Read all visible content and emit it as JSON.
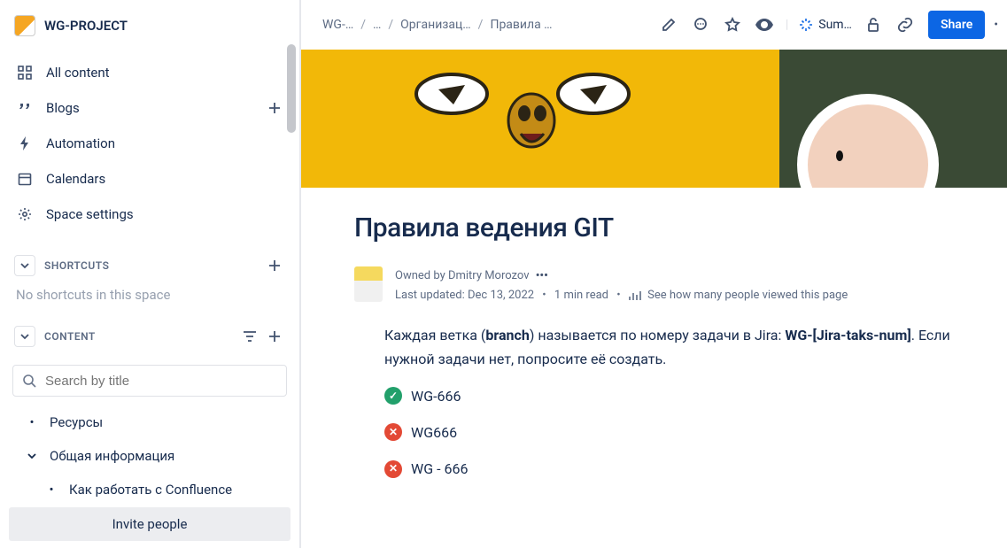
{
  "sidebar": {
    "spaceTitle": "WG-PROJECT",
    "nav": {
      "allContent": "All content",
      "blogs": "Blogs",
      "automation": "Automation",
      "calendars": "Calendars",
      "spaceSettings": "Space settings"
    },
    "sections": {
      "shortcuts": {
        "label": "SHORTCUTS",
        "empty": "No shortcuts in this space"
      },
      "content": {
        "label": "CONTENT"
      }
    },
    "searchPlaceholder": "Search by title",
    "tree": {
      "resources": "Ресурсы",
      "commonInfo": "Общая информация",
      "confluence": "Как работать с Confluence"
    },
    "invite": "Invite people"
  },
  "topbar": {
    "crumbs": [
      "WG-…",
      "…",
      "Организац…",
      "Правила …"
    ],
    "summarize": "Sum…",
    "share": "Share"
  },
  "page": {
    "title": "Правила ведения GIT",
    "ownedByPrefix": "Owned by ",
    "owner": "Dmitry Morozov",
    "updatedPrefix": "Last updated: ",
    "updated": "Dec 13, 2022",
    "readTime": "1 min read",
    "viewsLink": "See how many people viewed this page",
    "body": {
      "p1_a": "Каждая ветка (",
      "p1_bold": "branch",
      "p1_b": ") называется по номеру задачи в Jira: ",
      "p1_pattern": "WG-[Jira-taks-num]",
      "p1_c": ". Если нужной задачи нет, попросите её создать.",
      "ex_ok": "WG-666",
      "ex_bad1": "WG666",
      "ex_bad2": "WG - 666"
    }
  }
}
